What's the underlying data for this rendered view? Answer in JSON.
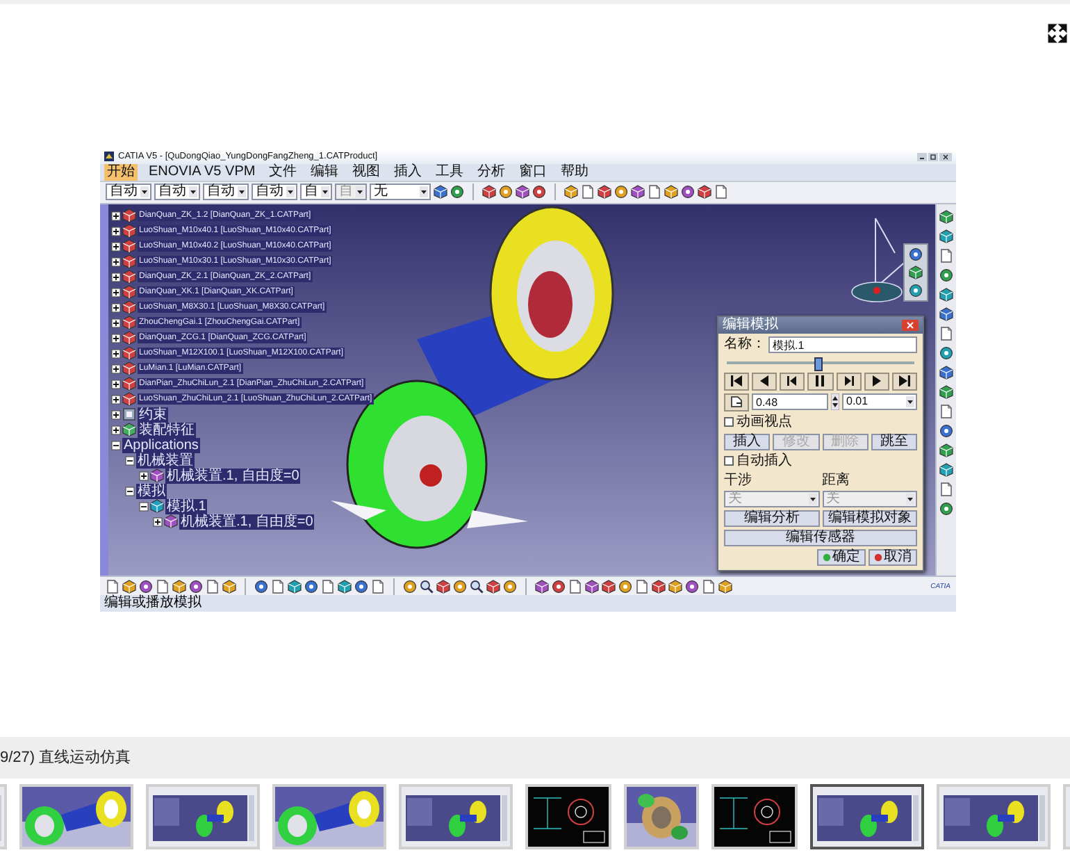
{
  "viewer": {
    "catia": {
      "title": "CATIA V5 - [QuDongQiao_YungDongFangZheng_1.CATProduct]",
      "menu": [
        {
          "label": "开始",
          "selected": true
        },
        {
          "label": "ENOVIA V5 VPM",
          "selected": false
        },
        {
          "label": "文件",
          "selected": false
        },
        {
          "label": "编辑",
          "selected": false
        },
        {
          "label": "视图",
          "selected": false
        },
        {
          "label": "插入",
          "selected": false
        },
        {
          "label": "工具",
          "selected": false
        },
        {
          "label": "分析",
          "selected": false
        },
        {
          "label": "窗口",
          "selected": false
        },
        {
          "label": "帮助",
          "selected": false
        }
      ],
      "toolbar_dropdowns": [
        {
          "value": "自动",
          "disabled": false
        },
        {
          "value": "自动",
          "disabled": false
        },
        {
          "value": "自动",
          "disabled": false
        },
        {
          "value": "自动",
          "disabled": false
        },
        {
          "value": "自",
          "disabled": false
        },
        {
          "value": "自",
          "disabled": true
        },
        {
          "value": "无",
          "disabled": false
        }
      ],
      "tree": [
        {
          "kind": "part",
          "label": "DianQuan_ZK_1.2 [DianQuan_ZK_1.CATPart]",
          "expanded": false
        },
        {
          "kind": "part",
          "label": "LuoShuan_M10x40.1 [LuoShuan_M10x40.CATPart]",
          "expanded": false
        },
        {
          "kind": "part",
          "label": "LuoShuan_M10x40.2 [LuoShuan_M10x40.CATPart]",
          "expanded": false
        },
        {
          "kind": "part",
          "label": "LuoShuan_M10x30.1 [LuoShuan_M10x30.CATPart]",
          "expanded": false
        },
        {
          "kind": "part",
          "label": "DianQuan_ZK_2.1 [DianQuan_ZK_2.CATPart]",
          "expanded": false
        },
        {
          "kind": "part",
          "label": "DianQuan_XK.1 [DianQuan_XK.CATPart]",
          "expanded": false
        },
        {
          "kind": "part",
          "label": "LuoShuan_M8X30.1 [LuoShuan_M8X30.CATPart]",
          "expanded": false
        },
        {
          "kind": "part",
          "label": "ZhouChengGai.1 [ZhouChengGai.CATPart]",
          "expanded": false
        },
        {
          "kind": "part",
          "label": "DianQuan_ZCG.1 [DianQuan_ZCG.CATPart]",
          "expanded": false
        },
        {
          "kind": "part",
          "label": "LuoShuan_M12X100.1 [LuoShuan_M12X100.CATPart]",
          "expanded": false
        },
        {
          "kind": "part",
          "label": "LuMian.1 [LuMian.CATPart]",
          "expanded": false
        },
        {
          "kind": "part",
          "label": "DianPian_ZhuChiLun_2.1 [DianPian_ZhuChiLun_2.CATPart]",
          "expanded": false
        },
        {
          "kind": "part",
          "label": "LuoShuan_ZhuChiLun_2.1 [LuoShuan_ZhuChiLun_2.CATPart]",
          "expanded": false
        },
        {
          "kind": "constraints",
          "label": "约束",
          "expanded": false
        },
        {
          "kind": "features",
          "label": "装配特征",
          "expanded": false
        },
        {
          "label": "Applications",
          "expanded": true,
          "children": [
            {
              "label": "机械装置",
              "expanded": true,
              "children": [
                {
                  "kind": "mechanism-instance",
                  "label": "机械装置.1, 自由度=0",
                  "expanded": false
                }
              ]
            },
            {
              "label": "模拟",
              "expanded": true,
              "children": [
                {
                  "kind": "simulation-instance",
                  "label": "模拟.1",
                  "expanded": true,
                  "children": [
                    {
                      "kind": "mechanism-instance",
                      "label": "机械装置.1, 自由度=0",
                      "expanded": false
                    }
                  ]
                }
              ]
            }
          ]
        }
      ],
      "dialog": {
        "title": "编辑模拟",
        "name_label": "名称：",
        "name_value": "模拟.1",
        "slider": {
          "level": 0.48
        },
        "speed_value": "0.48",
        "step_value": "0.01",
        "animate_viewpoint": {
          "label": "动画视点",
          "checked": false
        },
        "actions": [
          {
            "label": "插入",
            "disabled": false
          },
          {
            "label": "修改",
            "disabled": true
          },
          {
            "label": "删除",
            "disabled": true
          },
          {
            "label": "跳至",
            "disabled": false
          }
        ],
        "auto_insert": {
          "label": "自动插入",
          "checked": false
        },
        "groups": [
          {
            "label": "干涉",
            "value": "关",
            "disabled": true
          },
          {
            "label": "距离",
            "value": "关",
            "disabled": true
          }
        ],
        "wide_buttons": [
          "编辑分析",
          "编辑模拟对象"
        ],
        "sensor_button": "编辑传感器",
        "ok": "确定",
        "cancel": "取消"
      },
      "status": "编辑或播放模拟",
      "logo": "CATIA"
    },
    "caption": "9/27) 直线运动仿真",
    "thumbnails": [
      {
        "kind": "screen",
        "selected": false
      },
      {
        "kind": "model",
        "selected": false
      },
      {
        "kind": "screen",
        "selected": false
      },
      {
        "kind": "model",
        "selected": false
      },
      {
        "kind": "screen",
        "selected": false
      },
      {
        "kind": "drawing",
        "selected": false
      },
      {
        "kind": "part",
        "selected": false
      },
      {
        "kind": "drawing",
        "selected": false
      },
      {
        "kind": "screen",
        "selected": true
      },
      {
        "kind": "screen",
        "selected": false
      },
      {
        "kind": "screen",
        "selected": false
      }
    ]
  }
}
